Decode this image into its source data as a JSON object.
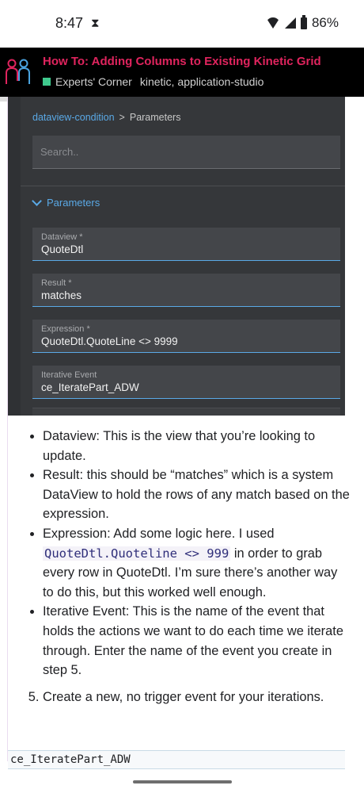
{
  "status_bar": {
    "time": "8:47",
    "battery": "86%"
  },
  "topic": {
    "title": "How To: Adding Columns to Existing Kinetic Grid",
    "category": "Experts' Corner",
    "tags": [
      "kinetic,",
      "application-studio"
    ],
    "category_color": "#3fc98d",
    "title_color": "#e0245e"
  },
  "screenshot": {
    "breadcrumb_link": "dataview-condition",
    "breadcrumb_sep": ">",
    "breadcrumb_current": "Parameters",
    "search_placeholder": "Search..",
    "section": "Parameters",
    "fields": [
      {
        "label": "Dataview *",
        "value": "QuoteDtl"
      },
      {
        "label": "Result *",
        "value": "matches"
      },
      {
        "label": "Expression *",
        "value": "QuoteDtl.QuoteLine <> 9999"
      },
      {
        "label": "Iterative Event",
        "value": "ce_IteratePart_ADW"
      }
    ]
  },
  "article": {
    "bullets": {
      "dataview": "Dataview: This is the view that you’re looking to update.",
      "result": "Result: this should be “matches” which is a system DataView to hold the rows of any match based on the expression.",
      "expression_before": "Expression: Add some logic here. I used ",
      "expression_code": "QuoteDtl.Quoteline <> 999",
      "expression_after": " in order to grab every row in QuoteDtl. I’m sure there’s another way to do this, but this worked well enough.",
      "iterative": "Iterative Event: This is the name of the event that holds the actions we want to do each time we iterate through. Enter the name of the event you create in step 5."
    },
    "step5": "Create a new, no trigger event for your iterations."
  },
  "code_block": "ce_IteratePart_ADW"
}
